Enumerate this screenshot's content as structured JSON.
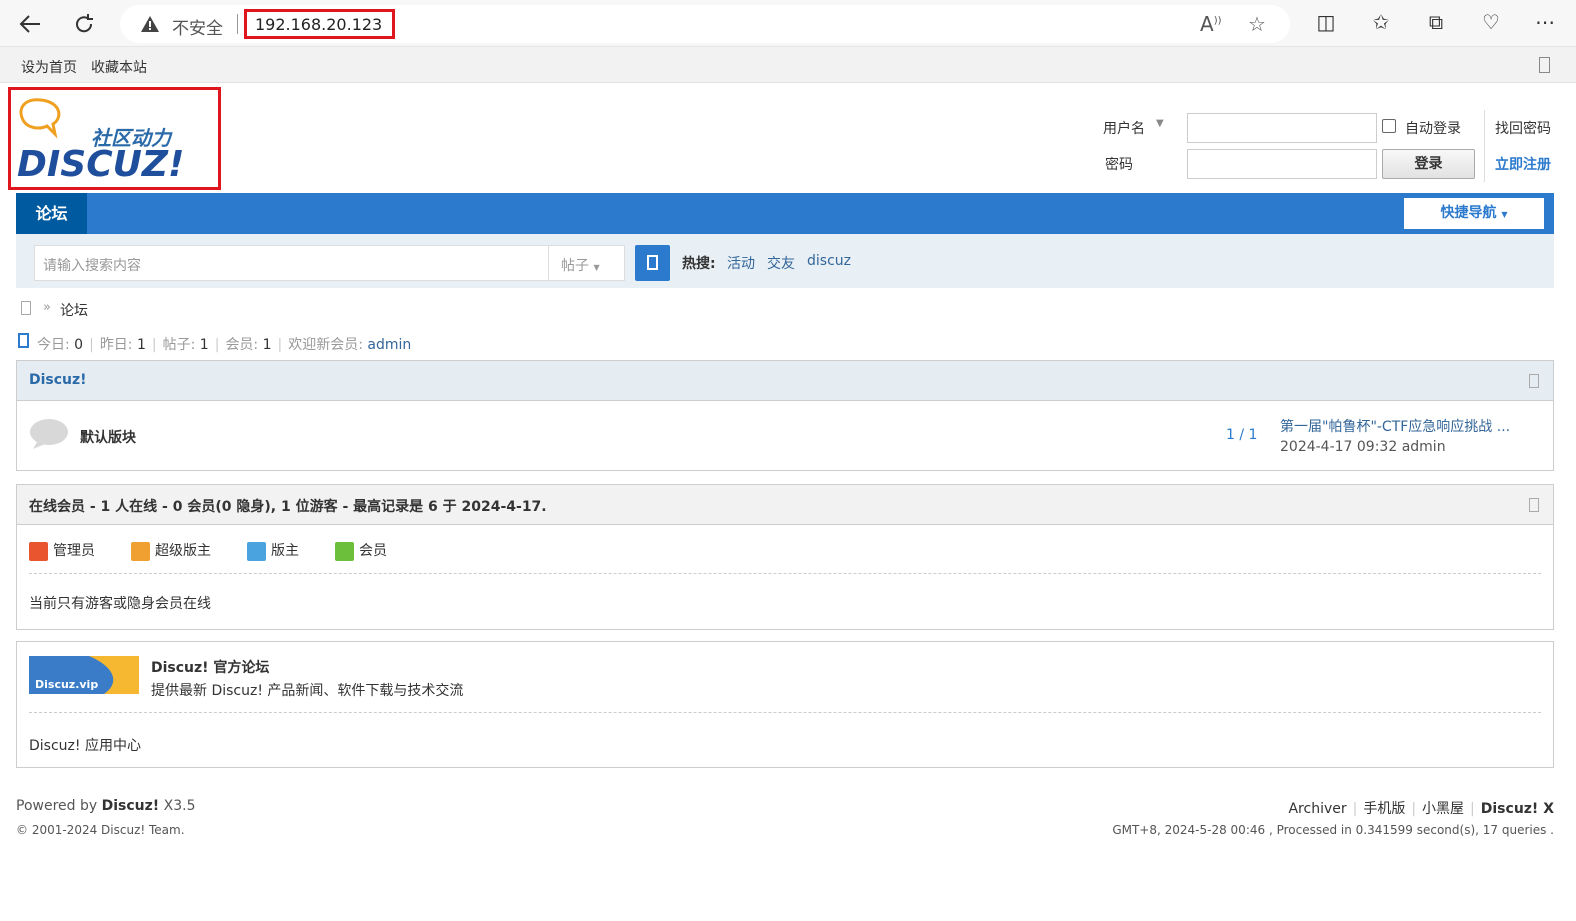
{
  "browser": {
    "insecure_label": "不安全",
    "url": "192.168.20.123"
  },
  "topbar": {
    "set_home": "设为首页",
    "bookmark": "收藏本站"
  },
  "logo": {
    "slogan": "社区动力",
    "wordmark": "DISCUZ!"
  },
  "login": {
    "username_label": "用户名",
    "password_label": "密码",
    "auto_login": "自动登录",
    "login_button": "登录",
    "forgot_password": "找回密码",
    "register": "立即注册"
  },
  "nav": {
    "forum_tab": "论坛",
    "quick_nav": "快捷导航"
  },
  "search": {
    "placeholder": "请输入搜索内容",
    "type": "帖子",
    "hot_label": "热搜:",
    "hot_terms": [
      "活动",
      "交友",
      "discuz"
    ]
  },
  "breadcrumb": {
    "current": "论坛"
  },
  "stats": {
    "today_label": "今日:",
    "today": "0",
    "yesterday_label": "昨日:",
    "yesterday": "1",
    "posts_label": "帖子:",
    "posts": "1",
    "members_label": "会员:",
    "members": "1",
    "welcome_label": "欢迎新会员:",
    "newest_member": "admin"
  },
  "forum_group": {
    "title": "Discuz!",
    "forums": [
      {
        "name": "默认版块",
        "count": "1 / 1",
        "last_post_title": "第一届\"帕鲁杯\"-CTF应急响应挑战 ...",
        "last_post_meta": "2024-4-17 09:32 admin"
      }
    ]
  },
  "online": {
    "title": "在线会员 - 1 人在线 - 0 会员(0 隐身), 1 位游客 - 最高记录是 6 于 2024-4-17.",
    "legend": [
      {
        "label": "管理员",
        "color": "#e8552f"
      },
      {
        "label": "超级版主",
        "color": "#f0a030"
      },
      {
        "label": "版主",
        "color": "#4aa3df"
      },
      {
        "label": "会员",
        "color": "#6cbf3a"
      }
    ],
    "note": "当前只有游客或隐身会员在线"
  },
  "friend_links": {
    "name": "Discuz! 官方论坛",
    "description": "提供最新 Discuz! 产品新闻、软件下载与技术交流",
    "logo_text": "Discuz.vip",
    "app_center": "Discuz! 应用中心"
  },
  "footer": {
    "powered_prefix": "Powered by",
    "powered_brand": "Discuz!",
    "version": "X3.5",
    "copyright": "© 2001-2024 Discuz! Team.",
    "links": [
      "Archiver",
      "手机版",
      "小黑屋"
    ],
    "brand_right": "Discuz! X",
    "server_info": "GMT+8, 2024-5-28 00:46 , Processed in 0.341599 second(s), 17 queries ."
  }
}
